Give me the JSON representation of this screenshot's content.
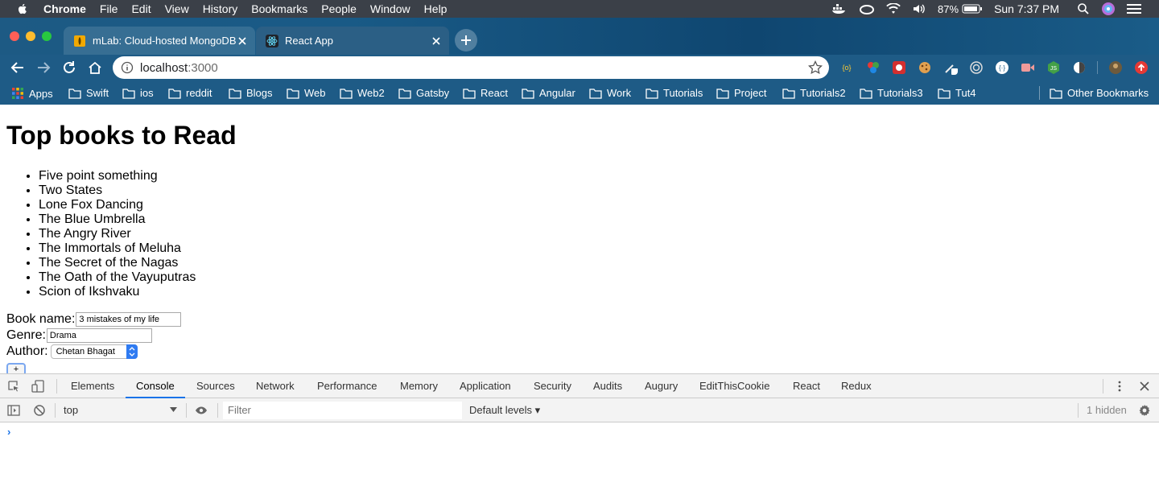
{
  "menubar": {
    "app_name": "Chrome",
    "items": [
      "File",
      "Edit",
      "View",
      "History",
      "Bookmarks",
      "People",
      "Window",
      "Help"
    ],
    "battery": "87%",
    "clock": "Sun 7:37 PM"
  },
  "tabs": [
    {
      "title": "mLab: Cloud-hosted MongoDB",
      "active": false
    },
    {
      "title": "React App",
      "active": true
    }
  ],
  "toolbar": {
    "url_host": "localhost",
    "url_port": ":3000"
  },
  "bookmarks": {
    "items": [
      "Apps",
      "Swift",
      "ios",
      "reddit",
      "Blogs",
      "Web",
      "Web2",
      "Gatsby",
      "React",
      "Angular",
      "Work",
      "Tutorials",
      "Project",
      "Tutorials2",
      "Tutorials3",
      "Tut4"
    ],
    "other": "Other Bookmarks"
  },
  "page": {
    "title": "Top books to Read",
    "books": [
      "Five point something",
      "Two States",
      "Lone Fox Dancing",
      "The Blue Umbrella",
      "The Angry River",
      "The Immortals of Meluha",
      "The Secret of the Nagas",
      "The Oath of the Vayuputras",
      "Scion of Ikshvaku"
    ],
    "form": {
      "book_label": "Book name:",
      "book_value": "3 mistakes of my life",
      "genre_label": "Genre:",
      "genre_value": "Drama",
      "author_label": "Author:",
      "author_value": "Chetan Bhagat",
      "add_label": "+"
    }
  },
  "devtools": {
    "tabs": [
      "Elements",
      "Console",
      "Sources",
      "Network",
      "Performance",
      "Memory",
      "Application",
      "Security",
      "Audits",
      "Augury",
      "EditThisCookie",
      "React",
      "Redux"
    ],
    "active_tab": "Console",
    "context": "top",
    "filter_placeholder": "Filter",
    "levels": "Default levels ▾",
    "hidden": "1 hidden",
    "prompt": "›"
  },
  "colors": {
    "chrome_frame": "#1e5b86",
    "menubar": "#3b4048",
    "accent": "#1a73e8"
  }
}
